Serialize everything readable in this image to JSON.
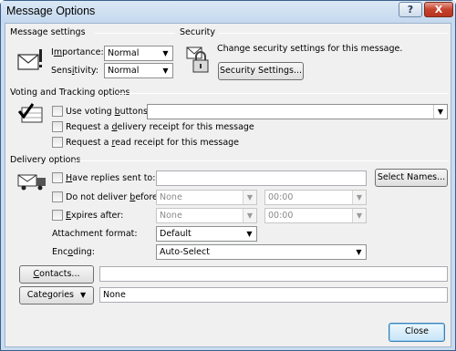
{
  "window": {
    "title": "Message Options",
    "help_label": "?",
    "close_glyph": "X"
  },
  "message_settings": {
    "heading": "Message settings",
    "importance": {
      "label": "Importance:",
      "value": "Normal"
    },
    "sensitivity": {
      "label": "Sensitivity:",
      "value": "Normal"
    }
  },
  "security": {
    "heading": "Security",
    "description": "Change security settings for this message.",
    "button_label": "Security Settings..."
  },
  "voting": {
    "heading": "Voting and Tracking options",
    "use_voting_label": "Use voting buttons:",
    "use_voting_value": "",
    "delivery_receipt_label": "Request a delivery receipt for this message",
    "read_receipt_label": "Request a read receipt for this message"
  },
  "delivery": {
    "heading": "Delivery options",
    "replies_label": "Have replies sent to:",
    "replies_value": "",
    "select_names_label": "Select Names...",
    "do_not_deliver_label": "Do not deliver before:",
    "do_not_deliver_date": "None",
    "do_not_deliver_time": "00:00",
    "expires_label": "Expires after:",
    "expires_date": "None",
    "expires_time": "00:00",
    "attachment_format_label": "Attachment format:",
    "attachment_format_value": "Default",
    "encoding_label": "Encoding:",
    "encoding_value": "Auto-Select"
  },
  "contacts": {
    "button_label": "Contacts...",
    "value": ""
  },
  "categories": {
    "button_label": "Categories",
    "value": "None"
  },
  "footer": {
    "close_label": "Close"
  }
}
